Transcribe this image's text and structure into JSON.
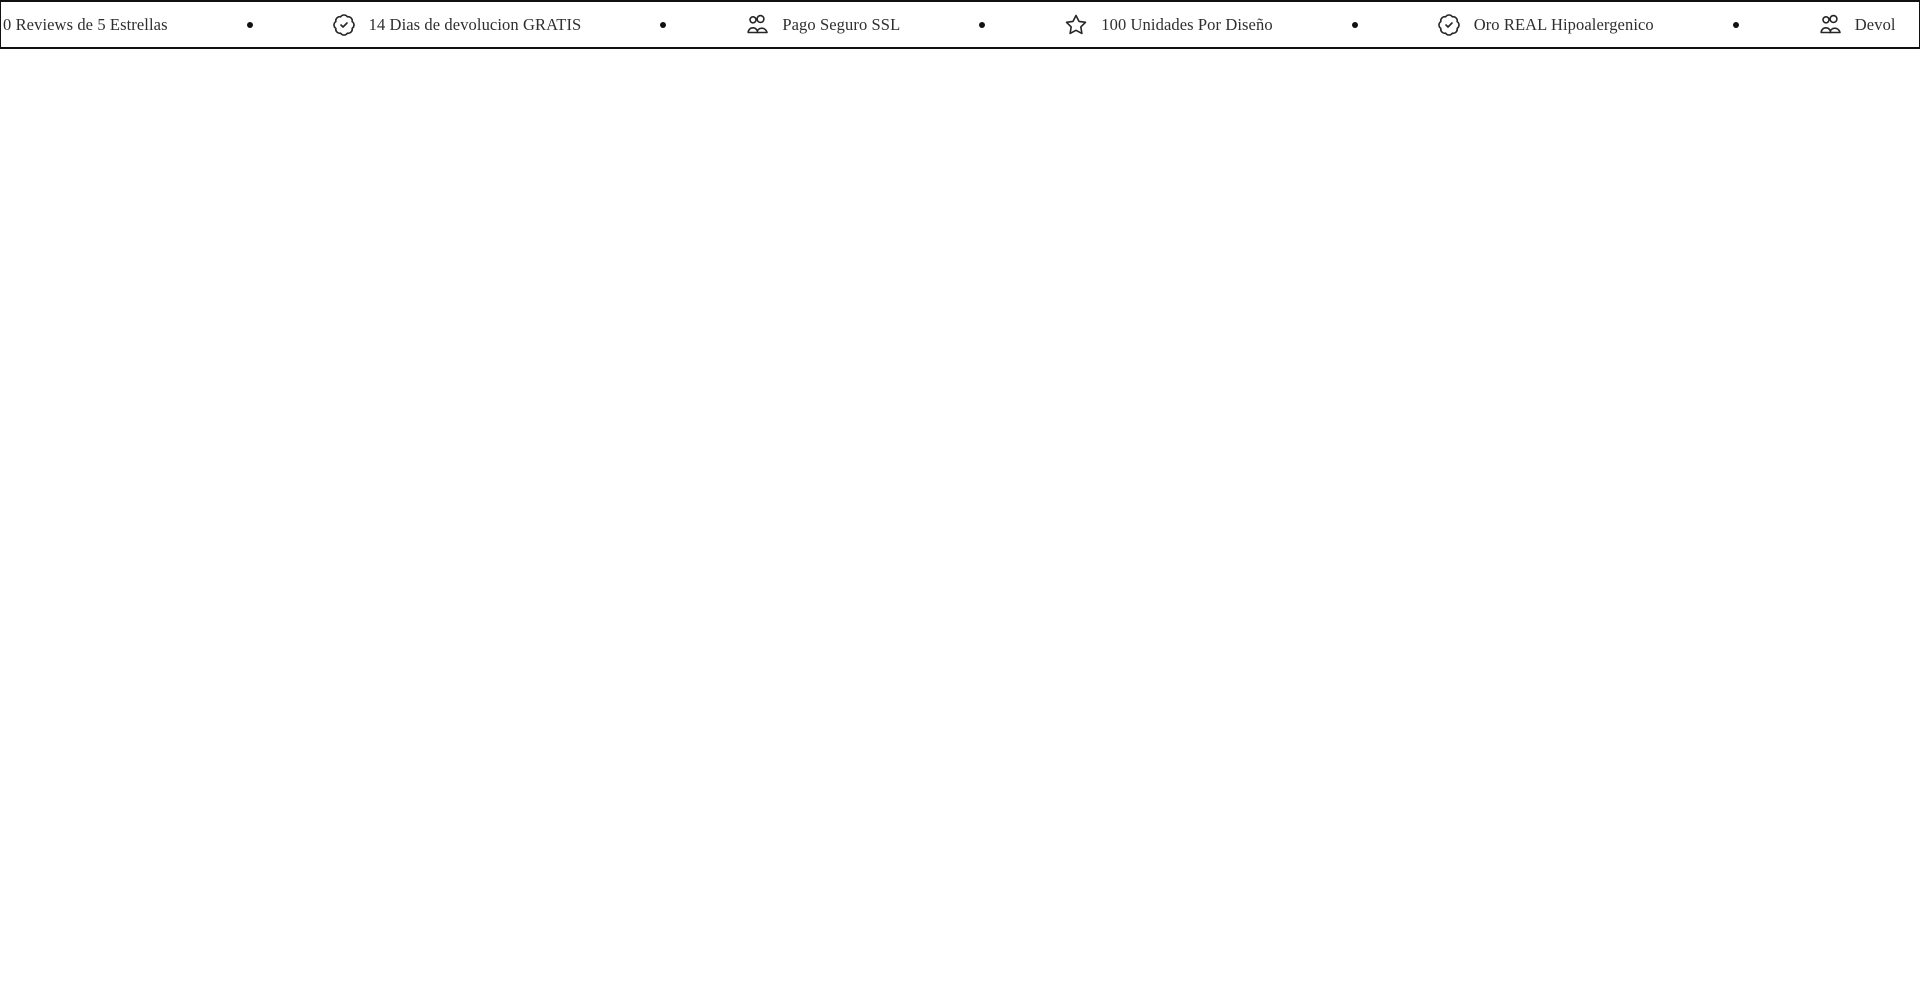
{
  "page": {
    "background": "#ffffff"
  },
  "announcement_bar": {
    "background": "#ffffff",
    "border_color": "#101010",
    "text_color": "#2f2f2f",
    "icon_color": "#262626",
    "separator_style": "dot",
    "items": [
      {
        "icon": "none",
        "label": "0 Reviews de 5 Estrellas"
      },
      {
        "icon": "badge-check",
        "label": "14 Dias de devolucion GRATIS"
      },
      {
        "icon": "users",
        "label": "Pago Seguro SSL"
      },
      {
        "icon": "star",
        "label": "100 Unidades Por Diseño"
      },
      {
        "icon": "badge-check",
        "label": "Oro REAL Hipoalergenico"
      },
      {
        "icon": "users",
        "label": "Devol"
      }
    ]
  }
}
